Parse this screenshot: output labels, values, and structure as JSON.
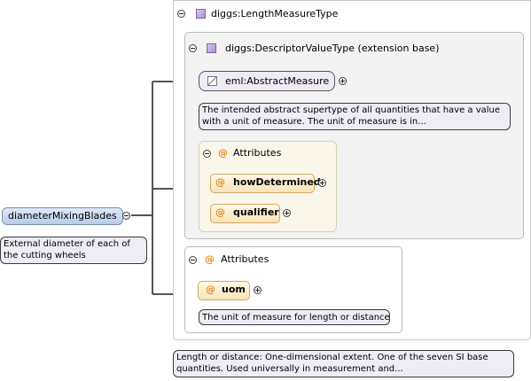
{
  "root_element": {
    "label": "diameterMixingBlades",
    "note_lines": [
      "External diameter of each of",
      "the cutting wheels"
    ]
  },
  "type_panel": {
    "title": "diggs:LengthMeasureType",
    "note_lines": [
      "Length or distance: One-dimensional extent. One of the seven SI base",
      "quantities. Used universally in measurement and..."
    ]
  },
  "extension_panel": {
    "title": "diggs:DescriptorValueType (extension base)",
    "abstract_element": {
      "label": "eml:AbstractMeasure",
      "note_lines": [
        "The intended abstract supertype of all quantities that have a value",
        "with a unit of measure. The unit of measure is in..."
      ]
    },
    "attributes": {
      "title": "Attributes",
      "items": [
        {
          "label": "howDetermined"
        },
        {
          "label": "qualifier"
        }
      ]
    }
  },
  "outer_attributes": {
    "title": "Attributes",
    "items": [
      {
        "label": "uom",
        "note": "The unit of measure for length or distance."
      }
    ]
  },
  "icons": {
    "at_symbol": "@",
    "type": "complex-type-icon",
    "abstract": "abstract-element-icon",
    "collapse": "minus-circle-icon",
    "expand": "plus-circle-icon"
  }
}
